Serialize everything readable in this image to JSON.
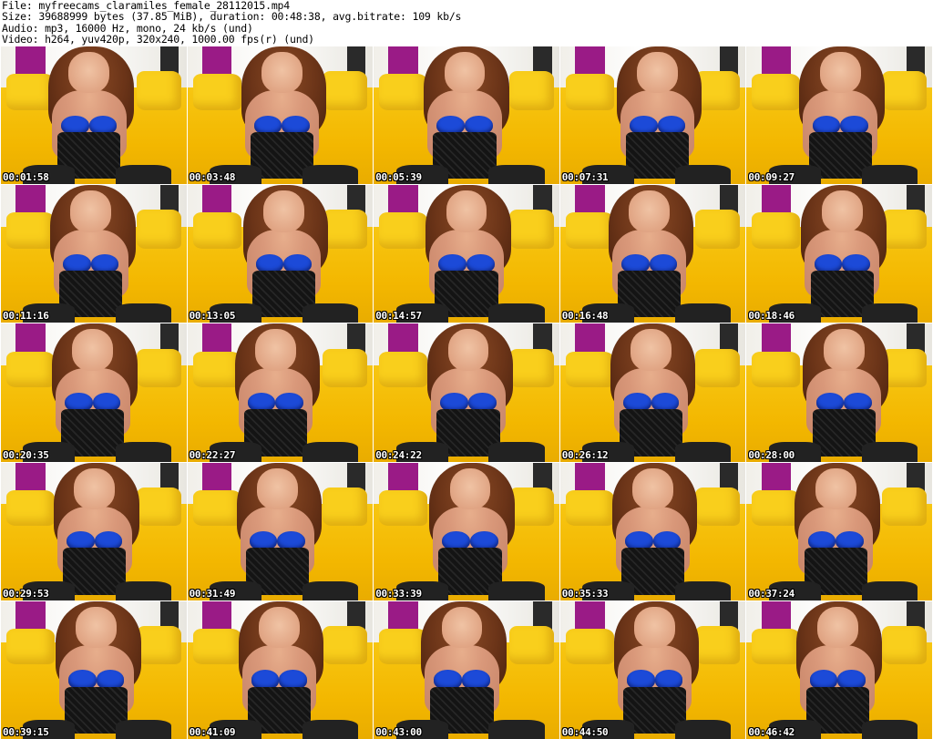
{
  "header": {
    "file_line": "File: myfreecams_claramiles_female_28112015.mp4",
    "size_line": "Size: 39688999 bytes (37.85 MiB), duration: 00:48:38, avg.bitrate: 109 kb/s",
    "audio_line": "Audio: mp3, 16000 Hz, mono, 24 kb/s (und)",
    "video_line": "Video: h264, yuv420p, 320x240, 1000.00 fps(r) (und)"
  },
  "thumbnails": [
    {
      "timestamp": "00:01:58"
    },
    {
      "timestamp": "00:03:48"
    },
    {
      "timestamp": "00:05:39"
    },
    {
      "timestamp": "00:07:31"
    },
    {
      "timestamp": "00:09:27"
    },
    {
      "timestamp": "00:11:16"
    },
    {
      "timestamp": "00:13:05"
    },
    {
      "timestamp": "00:14:57"
    },
    {
      "timestamp": "00:16:48"
    },
    {
      "timestamp": "00:18:46"
    },
    {
      "timestamp": "00:20:35"
    },
    {
      "timestamp": "00:22:27"
    },
    {
      "timestamp": "00:24:22"
    },
    {
      "timestamp": "00:26:12"
    },
    {
      "timestamp": "00:28:00"
    },
    {
      "timestamp": "00:29:53"
    },
    {
      "timestamp": "00:31:49"
    },
    {
      "timestamp": "00:33:39"
    },
    {
      "timestamp": "00:35:33"
    },
    {
      "timestamp": "00:37:24"
    },
    {
      "timestamp": "00:39:15"
    },
    {
      "timestamp": "00:41:09"
    },
    {
      "timestamp": "00:43:00"
    },
    {
      "timestamp": "00:44:50"
    },
    {
      "timestamp": "00:46:42"
    }
  ],
  "colors": {
    "background": "#ffffff",
    "bed_yellow": "#f3b700",
    "wall_white": "#f1efe9",
    "accent_purple": "#9a1b86",
    "bra_blue": "#1c4ad8",
    "corset_black": "#141414",
    "timestamp_text": "#ffffff"
  }
}
